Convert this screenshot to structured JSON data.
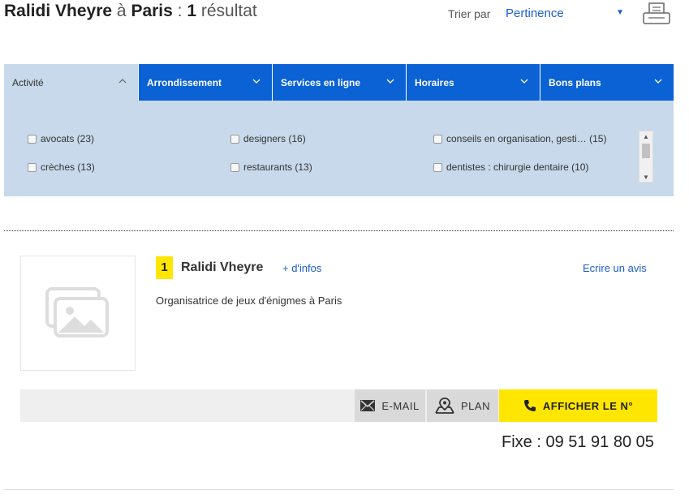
{
  "header": {
    "name": "Ralidi Vheyre",
    "preposition": "à",
    "city": "Paris",
    "separator": ":",
    "count": "1",
    "result_word": "résultat",
    "sort_label": "Trier par",
    "sort_value": "Pertinence"
  },
  "filters": {
    "tabs": [
      {
        "label": "Activité"
      },
      {
        "label": "Arrondissement"
      },
      {
        "label": "Services en ligne"
      },
      {
        "label": "Horaires"
      },
      {
        "label": "Bons plans"
      }
    ],
    "options": [
      {
        "label": "avocats (23)"
      },
      {
        "label": "crèches (13)"
      },
      {
        "label": "designers (16)"
      },
      {
        "label": "restaurants (13)"
      },
      {
        "label": "conseils en organisation, gesti…  (15)"
      },
      {
        "label": "dentistes : chirurgie dentaire (10)"
      }
    ]
  },
  "result": {
    "rank": "1",
    "name": "Ralidi Vheyre",
    "more_info": "+ d'infos",
    "write_review": "Ecrire un avis",
    "description": "Organisatrice de jeux d'énigmes à Paris",
    "actions": {
      "email": "E-MAIL",
      "plan": "PLAN",
      "phone": "AFFICHER LE N°"
    },
    "phone_label": "Fixe : 09 51 91 80 05"
  },
  "colors": {
    "accent_blue": "#0a62d4",
    "filter_bg": "#c7d9ea",
    "highlight_yellow": "#ffe600",
    "link_blue": "#1b5fcc"
  }
}
